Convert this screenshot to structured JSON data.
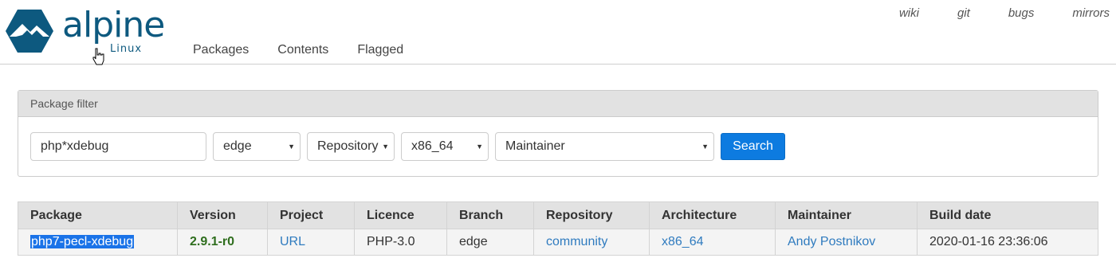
{
  "header": {
    "logo_word": "alpine",
    "logo_sub": "Linux",
    "main_nav": [
      "Packages",
      "Contents",
      "Flagged"
    ],
    "top_nav": [
      "wiki",
      "git",
      "bugs",
      "mirrors"
    ]
  },
  "filter": {
    "title": "Package filter",
    "name_value": "php*xdebug",
    "branch": "edge",
    "repository": "Repository",
    "arch": "x86_64",
    "maintainer": "Maintainer",
    "search_label": "Search"
  },
  "table": {
    "headers": [
      "Package",
      "Version",
      "Project",
      "Licence",
      "Branch",
      "Repository",
      "Architecture",
      "Maintainer",
      "Build date"
    ],
    "rows": [
      {
        "package": "php7-pecl-xdebug",
        "version": "2.9.1-r0",
        "project": "URL",
        "licence": "PHP-3.0",
        "branch": "edge",
        "repository": "community",
        "architecture": "x86_64",
        "maintainer": "Andy Postnikov",
        "build_date": "2020-01-16 23:36:06"
      }
    ]
  },
  "colors": {
    "brand": "#0d597f",
    "button": "#0d7be0",
    "version": "#2f6e1e",
    "link": "#2f7bbf",
    "selection": "#1a73e8"
  }
}
